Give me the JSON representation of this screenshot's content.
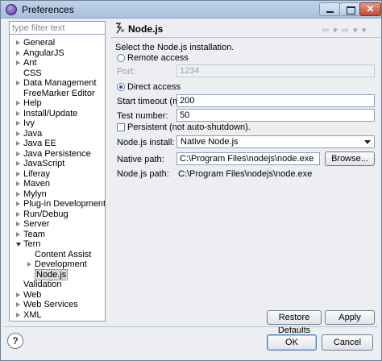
{
  "window": {
    "title": "Preferences",
    "close_glyph": "✕"
  },
  "filter": {
    "placeholder": "type filter text"
  },
  "tree": {
    "items": [
      {
        "label": "General",
        "arrow": "right",
        "level": 0
      },
      {
        "label": "AngularJS",
        "arrow": "right",
        "level": 0
      },
      {
        "label": "Ant",
        "arrow": "right",
        "level": 0
      },
      {
        "label": "CSS",
        "arrow": "none",
        "level": 0
      },
      {
        "label": "Data Management",
        "arrow": "right",
        "level": 0
      },
      {
        "label": "FreeMarker Editor",
        "arrow": "none",
        "level": 0
      },
      {
        "label": "Help",
        "arrow": "right",
        "level": 0
      },
      {
        "label": "Install/Update",
        "arrow": "right",
        "level": 0
      },
      {
        "label": "Ivy",
        "arrow": "right",
        "level": 0
      },
      {
        "label": "Java",
        "arrow": "right",
        "level": 0
      },
      {
        "label": "Java EE",
        "arrow": "right",
        "level": 0
      },
      {
        "label": "Java Persistence",
        "arrow": "right",
        "level": 0
      },
      {
        "label": "JavaScript",
        "arrow": "right",
        "level": 0
      },
      {
        "label": "Liferay",
        "arrow": "right",
        "level": 0
      },
      {
        "label": "Maven",
        "arrow": "right",
        "level": 0
      },
      {
        "label": "Mylyn",
        "arrow": "right",
        "level": 0
      },
      {
        "label": "Plug-in Development",
        "arrow": "right",
        "level": 0
      },
      {
        "label": "Run/Debug",
        "arrow": "right",
        "level": 0
      },
      {
        "label": "Server",
        "arrow": "right",
        "level": 0
      },
      {
        "label": "Team",
        "arrow": "right",
        "level": 0
      },
      {
        "label": "Tern",
        "arrow": "down",
        "level": 0
      },
      {
        "label": "Content Assist",
        "arrow": "none",
        "level": 1
      },
      {
        "label": "Development",
        "arrow": "right",
        "level": 1
      },
      {
        "label": "Node.js",
        "arrow": "none",
        "level": 1,
        "selected": true
      },
      {
        "label": "Validation",
        "arrow": "none",
        "level": 0
      },
      {
        "label": "Web",
        "arrow": "right",
        "level": 0
      },
      {
        "label": "Web Services",
        "arrow": "right",
        "level": 0
      },
      {
        "label": "XML",
        "arrow": "right",
        "level": 0
      }
    ]
  },
  "page": {
    "title": "Node.js",
    "nav_back": "⇦ ▾",
    "nav_forward": "⇨ ▾",
    "menu": "▾",
    "description": "Select the Node.js installation.",
    "remote_access_label": "Remote access",
    "port_label": "Port:",
    "port_value": "1234",
    "direct_access_label": "Direct access",
    "start_timeout_label": "Start timeout (ms):",
    "start_timeout_value": "200",
    "test_number_label": "Test number:",
    "test_number_value": "50",
    "persistent_label": "Persistent (not auto-shutdown).",
    "install_label": "Node.js install:",
    "install_value": "Native Node.js",
    "native_path_label": "Native path:",
    "native_path_value": "C:\\Program Files\\nodejs\\node.exe",
    "browse_label": "Browse...",
    "path_label": "Node.js path:",
    "path_value": "C:\\Program Files\\nodejs\\node.exe"
  },
  "buttons": {
    "restore_defaults": "Restore Defaults",
    "apply": "Apply",
    "ok": "OK",
    "cancel": "Cancel",
    "help_glyph": "?"
  }
}
